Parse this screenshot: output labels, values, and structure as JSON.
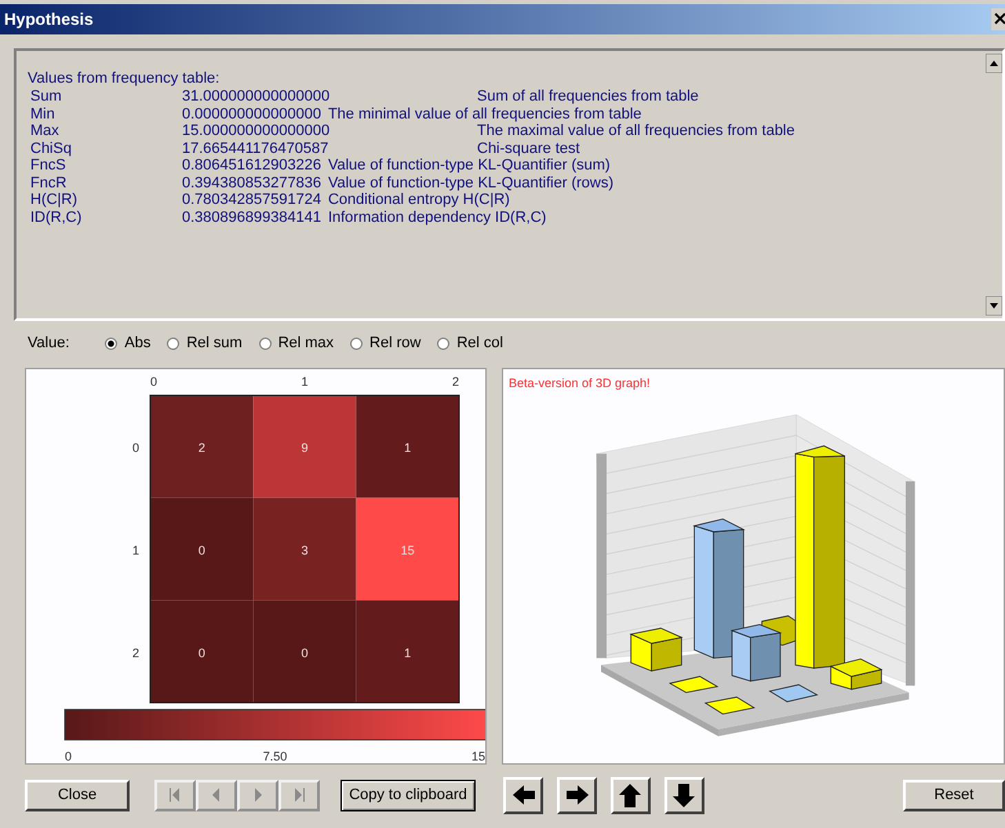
{
  "window": {
    "title": "Hypothesis"
  },
  "results": {
    "heading": "Values from frequency table:",
    "rows": [
      {
        "name": "Sum",
        "value": "31.000000000000000",
        "description": "Sum of all frequencies from table",
        "kind": "tabbed"
      },
      {
        "name": "Min",
        "value": "0.000000000000000",
        "description": "The minimal value of all frequencies from table",
        "kind": "inline"
      },
      {
        "name": "Max",
        "value": "15.000000000000000",
        "description": "The maximal value of all frequencies from table",
        "kind": "tabbed"
      },
      {
        "name": "ChiSq",
        "value": "17.665441176470587",
        "description": "Chi-square test",
        "kind": "tabbed"
      },
      {
        "name": "FncS",
        "value": "0.806451612903226",
        "description": "Value of function-type KL-Quantifier (sum)",
        "kind": "inline"
      },
      {
        "name": "FncR",
        "value": "0.394380853277836",
        "description": "Value of function-type KL-Quantifier (rows)",
        "kind": "inline"
      },
      {
        "name": "H(C|R)",
        "value": "0.780342857591724",
        "description": "Conditional entropy H(C|R)",
        "kind": "inline"
      },
      {
        "name": "ID(R,C)",
        "value": "0.380896899384141",
        "description": "Information dependency ID(R,C)",
        "kind": "inline"
      }
    ]
  },
  "value_mode": {
    "label": "Value:",
    "options": [
      {
        "label": "Abs",
        "selected": true
      },
      {
        "label": "Rel sum",
        "selected": false
      },
      {
        "label": "Rel max",
        "selected": false
      },
      {
        "label": "Rel row",
        "selected": false
      },
      {
        "label": "Rel col",
        "selected": false
      }
    ]
  },
  "heatmap": {
    "column_labels": [
      "0",
      "1",
      "2"
    ],
    "row_labels": [
      "0",
      "1",
      "2"
    ],
    "rows": [
      [
        "2",
        "9",
        "1"
      ],
      [
        "0",
        "3",
        "15"
      ],
      [
        "0",
        "0",
        "1"
      ]
    ],
    "scale_labels": [
      "0",
      "7.50",
      "15"
    ]
  },
  "graph_3d": {
    "caption": "Beta-version of 3D graph!"
  },
  "buttons": {
    "close": "Close",
    "navigation": [
      {
        "kind": "first",
        "disabled": true
      },
      {
        "kind": "previous",
        "disabled": true
      },
      {
        "kind": "next",
        "disabled": true
      },
      {
        "kind": "last",
        "disabled": true
      }
    ],
    "copy": "Copy to clipboard",
    "arrows": [
      {
        "kind": "left"
      },
      {
        "kind": "right"
      },
      {
        "kind": "up"
      },
      {
        "kind": "down"
      }
    ],
    "reset": "Reset"
  }
}
